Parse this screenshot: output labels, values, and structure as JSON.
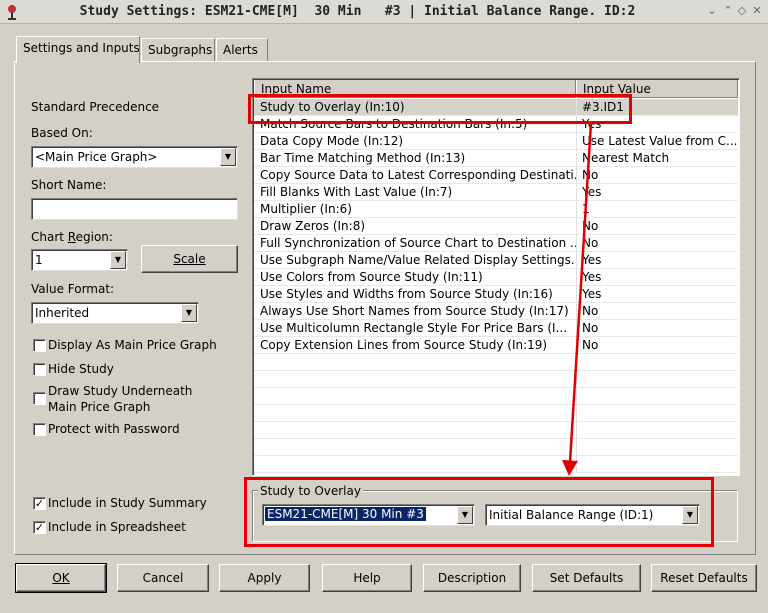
{
  "window": {
    "title": "Study Settings: ESM21-CME[M]  30 Min   #3 | Initial Balance Range. ID:2"
  },
  "tabs": [
    {
      "label": "Settings and Inputs"
    },
    {
      "label": "Subgraphs"
    },
    {
      "label": "Alerts"
    }
  ],
  "left": {
    "standard_precedence": "Standard Precedence",
    "based_on_label": "Based On:",
    "based_on_value": "<Main Price Graph>",
    "short_name_label": "Short Name:",
    "short_name_value": "",
    "chart_region_label": "Chart Region:",
    "chart_region_value": "1",
    "scale_button": "Scale",
    "value_format_label": "Value Format:",
    "value_format_value": "Inherited",
    "checkboxes": [
      {
        "label": "Display As Main Price Graph",
        "checked": false
      },
      {
        "label": "Hide Study",
        "checked": false
      },
      {
        "label": "Draw Study Underneath",
        "label2": "Main Price Graph",
        "checked": false
      },
      {
        "label": "Protect with Password",
        "checked": false
      },
      {
        "label": "Include in Study Summary",
        "checked": true
      },
      {
        "label": "Include in Spreadsheet",
        "checked": true
      }
    ]
  },
  "inputs_table": {
    "headers": [
      "Input Name",
      "Input Value"
    ],
    "rows": [
      {
        "name": "Study to Overlay    (In:10)",
        "value": "#3.ID1"
      },
      {
        "name": "Match Source Bars to Destination Bars   (In:5)",
        "value": "Yes"
      },
      {
        "name": "Data Copy Mode   (In:12)",
        "value": "Use Latest Value from C..."
      },
      {
        "name": "Bar Time Matching Method   (In:13)",
        "value": "Nearest Match"
      },
      {
        "name": "Copy Source Data to Latest Corresponding Destinati...",
        "value": "No"
      },
      {
        "name": "Fill Blanks With Last Value   (In:7)",
        "value": "Yes"
      },
      {
        "name": "Multiplier   (In:6)",
        "value": "1"
      },
      {
        "name": "Draw Zeros   (In:8)",
        "value": "No"
      },
      {
        "name": "Full Synchronization of Source Chart to Destination  ...",
        "value": "No"
      },
      {
        "name": "Use Subgraph Name/Value Related Display Settings...",
        "value": "Yes"
      },
      {
        "name": "Use Colors from Source Study   (In:11)",
        "value": "Yes"
      },
      {
        "name": "Use Styles and Widths from Source Study   (In:16)",
        "value": "Yes"
      },
      {
        "name": "Always Use Short Names from Source Study   (In:17)",
        "value": "No"
      },
      {
        "name": "Use Multicolumn Rectangle Style For Price Bars   (I...",
        "value": "No"
      },
      {
        "name": "Copy Extension Lines from Source Study   (In:19)",
        "value": "No"
      }
    ]
  },
  "overlay_group": {
    "title": "Study to Overlay",
    "chart_value": "ESM21-CME[M]  30 Min   #3",
    "study_value": "Initial Balance Range (ID:1)"
  },
  "buttons": {
    "ok": "OK",
    "cancel": "Cancel",
    "apply": "Apply",
    "help": "Help",
    "description": "Description",
    "set_defaults": "Set Defaults",
    "reset_defaults": "Reset Defaults"
  },
  "colors": {
    "highlight": "#e00000",
    "selection": "#0a246a"
  }
}
